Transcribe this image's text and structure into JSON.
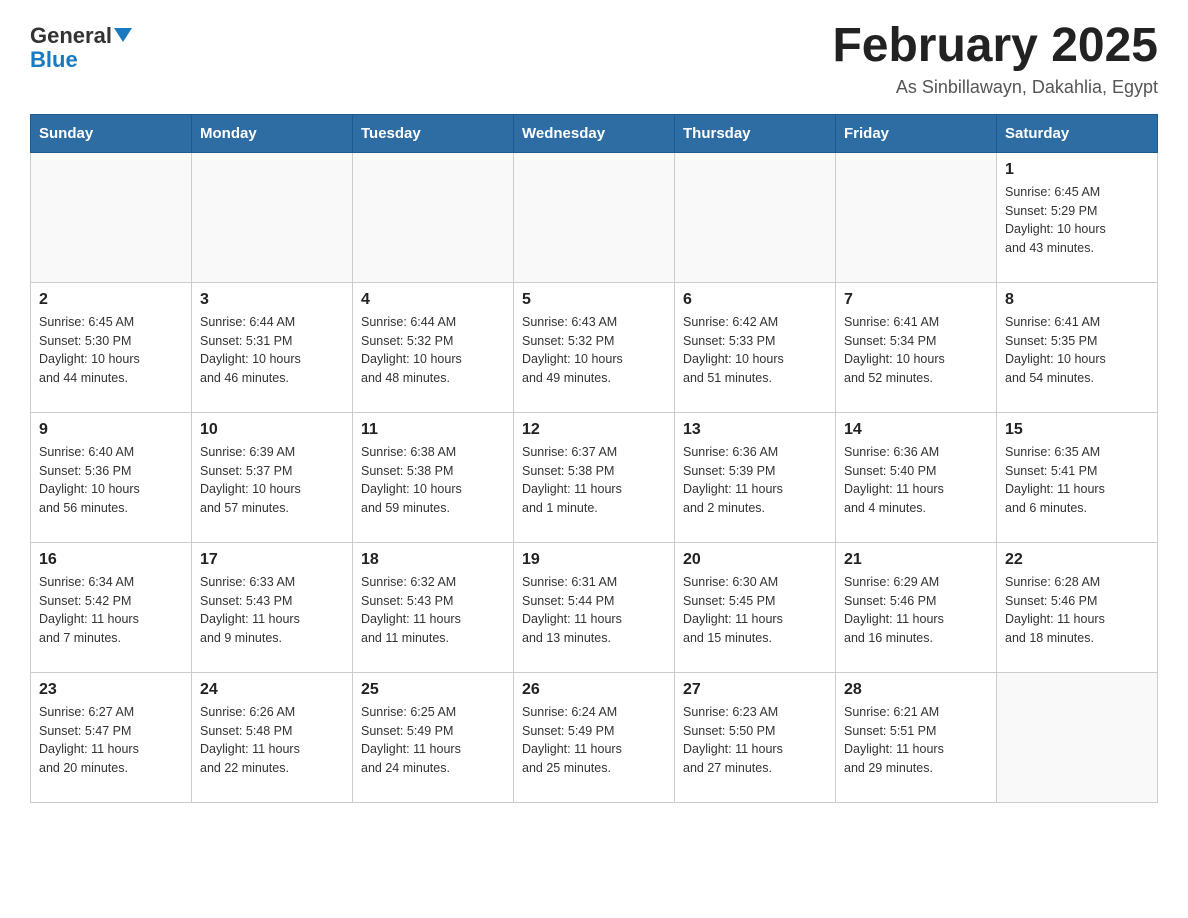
{
  "header": {
    "logo": {
      "general": "General",
      "blue": "Blue",
      "alt": "GeneralBlue logo"
    },
    "title": "February 2025",
    "subtitle": "As Sinbillawayn, Dakahlia, Egypt"
  },
  "weekdays": [
    "Sunday",
    "Monday",
    "Tuesday",
    "Wednesday",
    "Thursday",
    "Friday",
    "Saturday"
  ],
  "weeks": [
    [
      {
        "day": "",
        "info": ""
      },
      {
        "day": "",
        "info": ""
      },
      {
        "day": "",
        "info": ""
      },
      {
        "day": "",
        "info": ""
      },
      {
        "day": "",
        "info": ""
      },
      {
        "day": "",
        "info": ""
      },
      {
        "day": "1",
        "info": "Sunrise: 6:45 AM\nSunset: 5:29 PM\nDaylight: 10 hours\nand 43 minutes."
      }
    ],
    [
      {
        "day": "2",
        "info": "Sunrise: 6:45 AM\nSunset: 5:30 PM\nDaylight: 10 hours\nand 44 minutes."
      },
      {
        "day": "3",
        "info": "Sunrise: 6:44 AM\nSunset: 5:31 PM\nDaylight: 10 hours\nand 46 minutes."
      },
      {
        "day": "4",
        "info": "Sunrise: 6:44 AM\nSunset: 5:32 PM\nDaylight: 10 hours\nand 48 minutes."
      },
      {
        "day": "5",
        "info": "Sunrise: 6:43 AM\nSunset: 5:32 PM\nDaylight: 10 hours\nand 49 minutes."
      },
      {
        "day": "6",
        "info": "Sunrise: 6:42 AM\nSunset: 5:33 PM\nDaylight: 10 hours\nand 51 minutes."
      },
      {
        "day": "7",
        "info": "Sunrise: 6:41 AM\nSunset: 5:34 PM\nDaylight: 10 hours\nand 52 minutes."
      },
      {
        "day": "8",
        "info": "Sunrise: 6:41 AM\nSunset: 5:35 PM\nDaylight: 10 hours\nand 54 minutes."
      }
    ],
    [
      {
        "day": "9",
        "info": "Sunrise: 6:40 AM\nSunset: 5:36 PM\nDaylight: 10 hours\nand 56 minutes."
      },
      {
        "day": "10",
        "info": "Sunrise: 6:39 AM\nSunset: 5:37 PM\nDaylight: 10 hours\nand 57 minutes."
      },
      {
        "day": "11",
        "info": "Sunrise: 6:38 AM\nSunset: 5:38 PM\nDaylight: 10 hours\nand 59 minutes."
      },
      {
        "day": "12",
        "info": "Sunrise: 6:37 AM\nSunset: 5:38 PM\nDaylight: 11 hours\nand 1 minute."
      },
      {
        "day": "13",
        "info": "Sunrise: 6:36 AM\nSunset: 5:39 PM\nDaylight: 11 hours\nand 2 minutes."
      },
      {
        "day": "14",
        "info": "Sunrise: 6:36 AM\nSunset: 5:40 PM\nDaylight: 11 hours\nand 4 minutes."
      },
      {
        "day": "15",
        "info": "Sunrise: 6:35 AM\nSunset: 5:41 PM\nDaylight: 11 hours\nand 6 minutes."
      }
    ],
    [
      {
        "day": "16",
        "info": "Sunrise: 6:34 AM\nSunset: 5:42 PM\nDaylight: 11 hours\nand 7 minutes."
      },
      {
        "day": "17",
        "info": "Sunrise: 6:33 AM\nSunset: 5:43 PM\nDaylight: 11 hours\nand 9 minutes."
      },
      {
        "day": "18",
        "info": "Sunrise: 6:32 AM\nSunset: 5:43 PM\nDaylight: 11 hours\nand 11 minutes."
      },
      {
        "day": "19",
        "info": "Sunrise: 6:31 AM\nSunset: 5:44 PM\nDaylight: 11 hours\nand 13 minutes."
      },
      {
        "day": "20",
        "info": "Sunrise: 6:30 AM\nSunset: 5:45 PM\nDaylight: 11 hours\nand 15 minutes."
      },
      {
        "day": "21",
        "info": "Sunrise: 6:29 AM\nSunset: 5:46 PM\nDaylight: 11 hours\nand 16 minutes."
      },
      {
        "day": "22",
        "info": "Sunrise: 6:28 AM\nSunset: 5:46 PM\nDaylight: 11 hours\nand 18 minutes."
      }
    ],
    [
      {
        "day": "23",
        "info": "Sunrise: 6:27 AM\nSunset: 5:47 PM\nDaylight: 11 hours\nand 20 minutes."
      },
      {
        "day": "24",
        "info": "Sunrise: 6:26 AM\nSunset: 5:48 PM\nDaylight: 11 hours\nand 22 minutes."
      },
      {
        "day": "25",
        "info": "Sunrise: 6:25 AM\nSunset: 5:49 PM\nDaylight: 11 hours\nand 24 minutes."
      },
      {
        "day": "26",
        "info": "Sunrise: 6:24 AM\nSunset: 5:49 PM\nDaylight: 11 hours\nand 25 minutes."
      },
      {
        "day": "27",
        "info": "Sunrise: 6:23 AM\nSunset: 5:50 PM\nDaylight: 11 hours\nand 27 minutes."
      },
      {
        "day": "28",
        "info": "Sunrise: 6:21 AM\nSunset: 5:51 PM\nDaylight: 11 hours\nand 29 minutes."
      },
      {
        "day": "",
        "info": ""
      }
    ]
  ]
}
